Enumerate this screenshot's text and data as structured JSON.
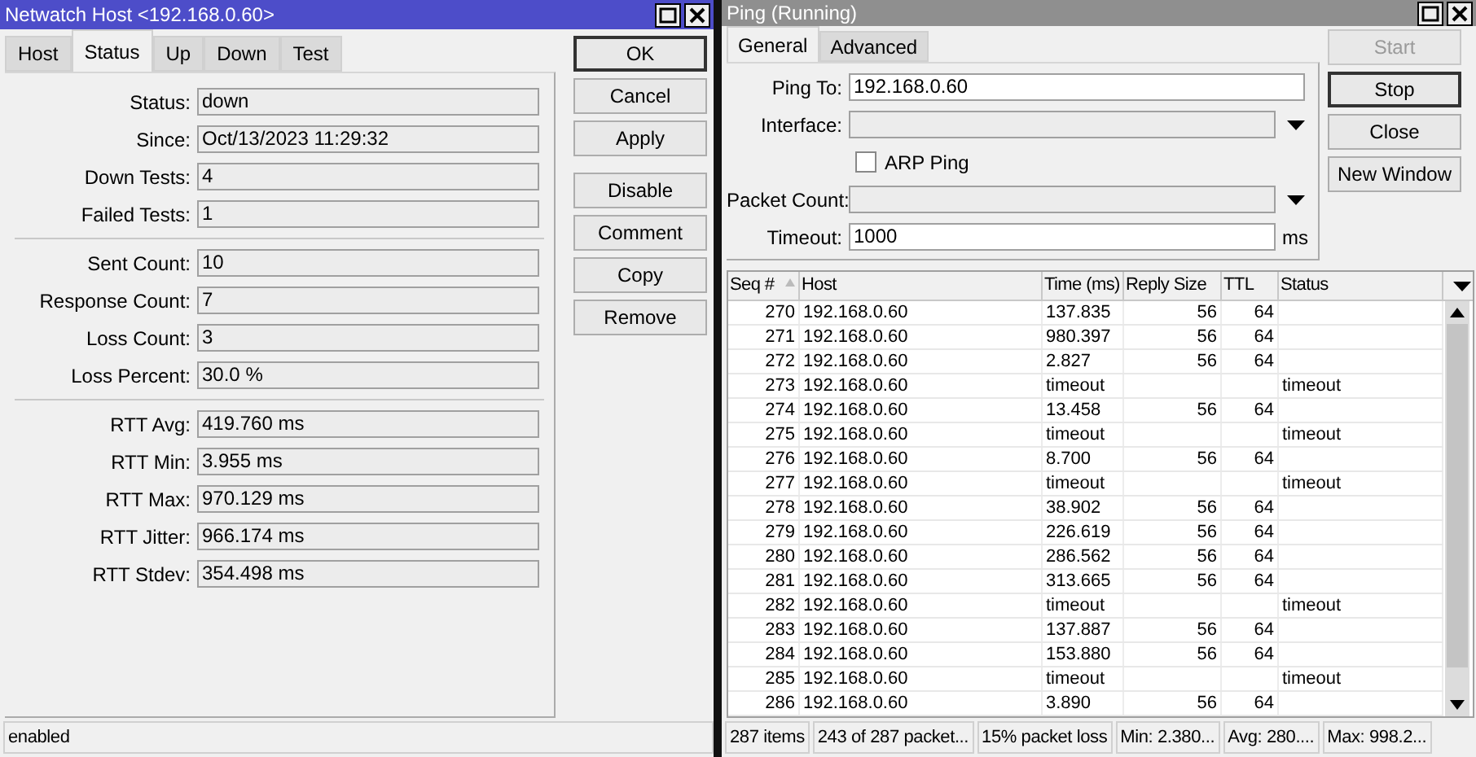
{
  "netwatch_window": {
    "title": "Netwatch Host <192.168.0.60>",
    "tabs": [
      {
        "label": "Host",
        "selected": false
      },
      {
        "label": "Status",
        "selected": true
      },
      {
        "label": "Up",
        "selected": false
      },
      {
        "label": "Down",
        "selected": false
      },
      {
        "label": "Test",
        "selected": false
      }
    ],
    "field_groups": [
      [
        {
          "label": "Status:",
          "value": "down"
        },
        {
          "label": "Since:",
          "value": "Oct/13/2023 11:29:32"
        },
        {
          "label": "Down Tests:",
          "value": "4"
        },
        {
          "label": "Failed Tests:",
          "value": "1"
        }
      ],
      [
        {
          "label": "Sent Count:",
          "value": "10"
        },
        {
          "label": "Response Count:",
          "value": "7"
        },
        {
          "label": "Loss Count:",
          "value": "3"
        },
        {
          "label": "Loss Percent:",
          "value": "30.0 %"
        }
      ],
      [
        {
          "label": "RTT Avg:",
          "value": "419.760 ms"
        },
        {
          "label": "RTT Min:",
          "value": "3.955 ms"
        },
        {
          "label": "RTT Max:",
          "value": "970.129 ms"
        },
        {
          "label": "RTT Jitter:",
          "value": "966.174 ms"
        },
        {
          "label": "RTT Stdev:",
          "value": "354.498 ms"
        }
      ]
    ],
    "button_groups": [
      [
        {
          "label": "OK",
          "default": true
        },
        {
          "label": "Cancel",
          "default": false
        },
        {
          "label": "Apply",
          "default": false
        }
      ],
      [
        {
          "label": "Disable",
          "default": false
        },
        {
          "label": "Comment",
          "default": false
        },
        {
          "label": "Copy",
          "default": false
        },
        {
          "label": "Remove",
          "default": false
        }
      ]
    ],
    "status_bar": "enabled"
  },
  "ping_window": {
    "title": "Ping (Running)",
    "tabs": [
      {
        "label": "General",
        "selected": true
      },
      {
        "label": "Advanced",
        "selected": false
      }
    ],
    "fields": [
      {
        "kind": "text",
        "label": "Ping To:",
        "value": "192.168.0.60"
      },
      {
        "kind": "dropdown",
        "label": "Interface:"
      },
      {
        "kind": "checkbox",
        "label": "ARP Ping",
        "checked": false
      },
      {
        "kind": "dropdown",
        "label": "Packet Count:"
      },
      {
        "kind": "unit",
        "label": "Timeout:",
        "value": "1000",
        "unit": "ms"
      }
    ],
    "buttons": [
      {
        "label": "Start",
        "disabled": true,
        "default": false
      },
      {
        "label": "Stop",
        "disabled": false,
        "default": true
      },
      {
        "label": "Close",
        "disabled": false,
        "default": false
      },
      {
        "label": "New Window",
        "disabled": false,
        "default": false
      }
    ],
    "table": {
      "columns": [
        "Seq #",
        "Host",
        "Time (ms)",
        "Reply Size",
        "TTL",
        "Status"
      ],
      "rows": [
        {
          "seq": "270",
          "host": "192.168.0.60",
          "time": "137.835",
          "reply_size": "56",
          "ttl": "64"
        },
        {
          "seq": "271",
          "host": "192.168.0.60",
          "time": "980.397",
          "reply_size": "56",
          "ttl": "64"
        },
        {
          "seq": "272",
          "host": "192.168.0.60",
          "time": "2.827",
          "reply_size": "56",
          "ttl": "64"
        },
        {
          "seq": "273",
          "host": "192.168.0.60",
          "time": "timeout",
          "status": "timeout"
        },
        {
          "seq": "274",
          "host": "192.168.0.60",
          "time": "13.458",
          "reply_size": "56",
          "ttl": "64"
        },
        {
          "seq": "275",
          "host": "192.168.0.60",
          "time": "timeout",
          "status": "timeout"
        },
        {
          "seq": "276",
          "host": "192.168.0.60",
          "time": "8.700",
          "reply_size": "56",
          "ttl": "64"
        },
        {
          "seq": "277",
          "host": "192.168.0.60",
          "time": "timeout",
          "status": "timeout"
        },
        {
          "seq": "278",
          "host": "192.168.0.60",
          "time": "38.902",
          "reply_size": "56",
          "ttl": "64"
        },
        {
          "seq": "279",
          "host": "192.168.0.60",
          "time": "226.619",
          "reply_size": "56",
          "ttl": "64"
        },
        {
          "seq": "280",
          "host": "192.168.0.60",
          "time": "286.562",
          "reply_size": "56",
          "ttl": "64"
        },
        {
          "seq": "281",
          "host": "192.168.0.60",
          "time": "313.665",
          "reply_size": "56",
          "ttl": "64"
        },
        {
          "seq": "282",
          "host": "192.168.0.60",
          "time": "timeout",
          "status": "timeout"
        },
        {
          "seq": "283",
          "host": "192.168.0.60",
          "time": "137.887",
          "reply_size": "56",
          "ttl": "64"
        },
        {
          "seq": "284",
          "host": "192.168.0.60",
          "time": "153.880",
          "reply_size": "56",
          "ttl": "64"
        },
        {
          "seq": "285",
          "host": "192.168.0.60",
          "time": "timeout",
          "status": "timeout"
        },
        {
          "seq": "286",
          "host": "192.168.0.60",
          "time": "3.890",
          "reply_size": "56",
          "ttl": "64"
        }
      ]
    },
    "status_bar": [
      "287 items",
      "243 of 287 packet...",
      "15% packet loss",
      "Min: 2.380...",
      "Avg: 280....",
      "Max: 998.2..."
    ]
  }
}
